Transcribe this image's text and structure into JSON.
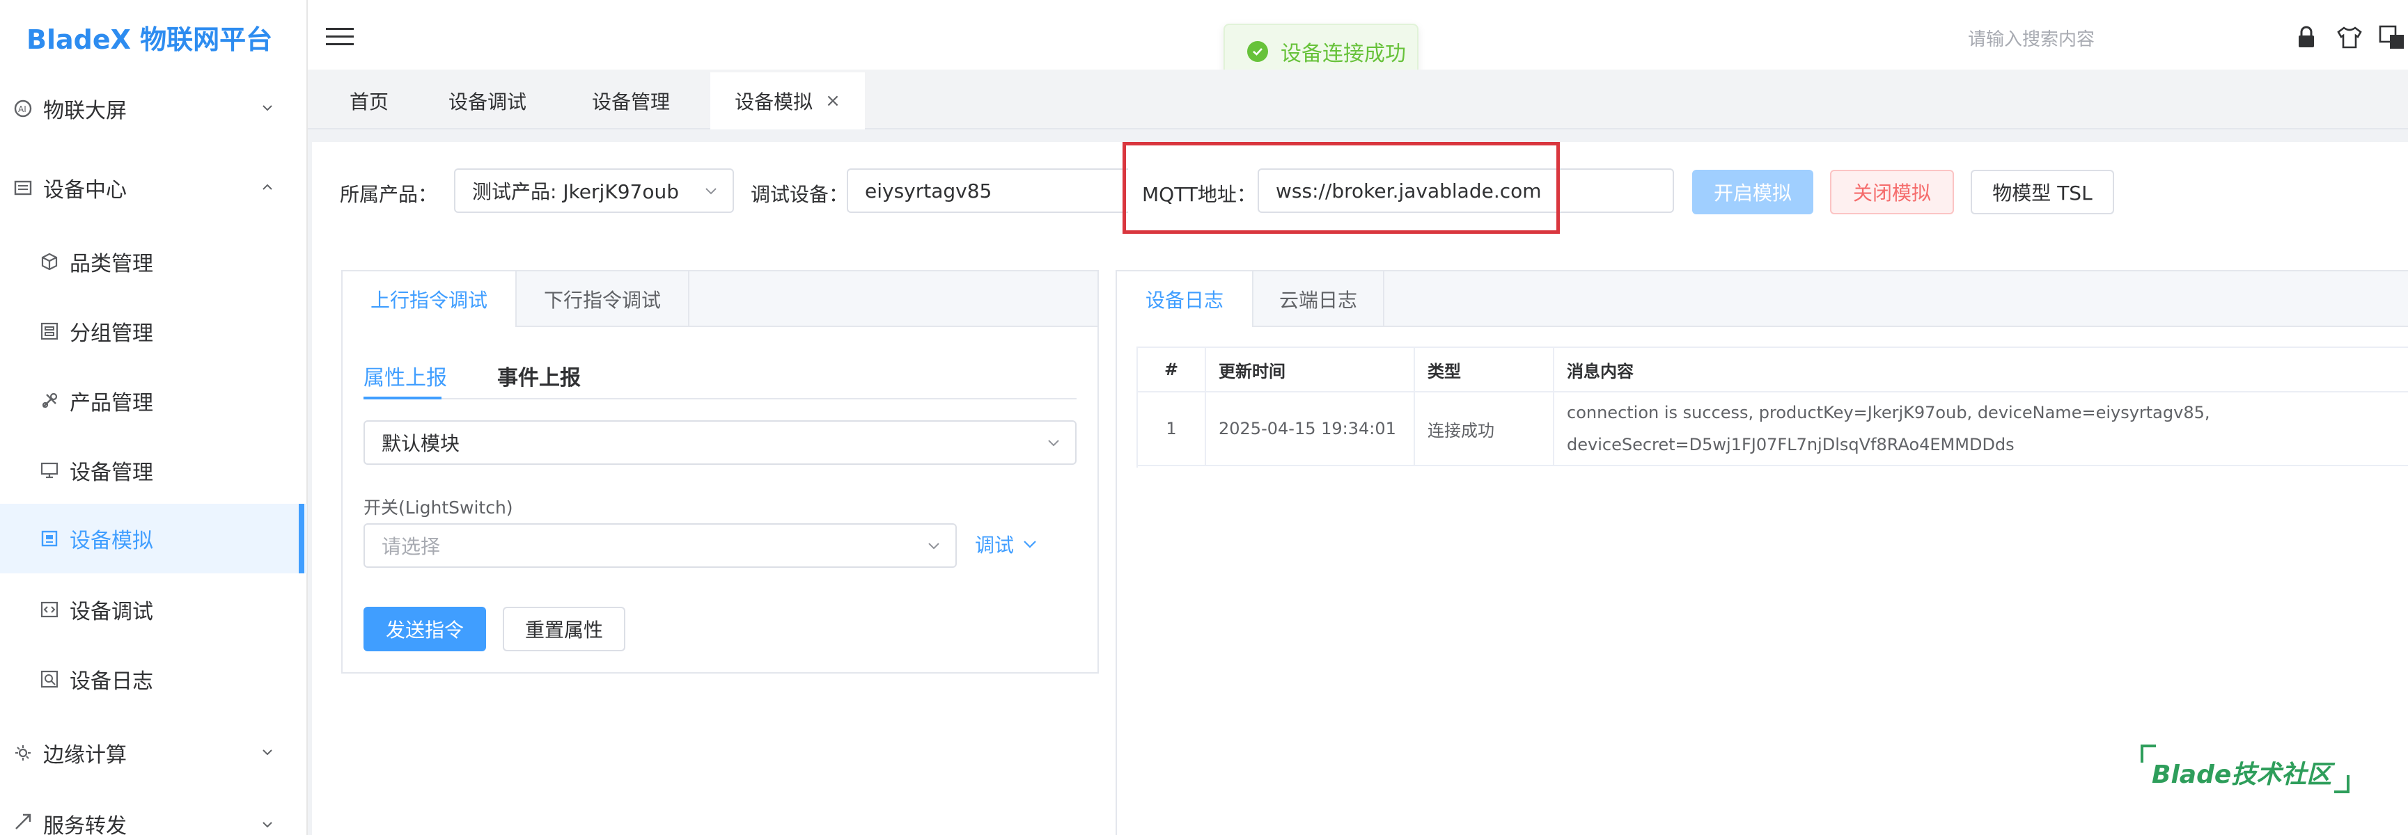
{
  "app": {
    "logo": "BladeX 物联网平台"
  },
  "sidebar": {
    "items": [
      {
        "label": "物联大屏",
        "icon": "ai-screen-icon",
        "chevron": "down"
      },
      {
        "label": "设备中心",
        "icon": "device-center-icon",
        "chevron": "up"
      },
      {
        "label": "品类管理",
        "icon": "cube-icon"
      },
      {
        "label": "分组管理",
        "icon": "group-icon"
      },
      {
        "label": "产品管理",
        "icon": "tools-icon"
      },
      {
        "label": "设备管理",
        "icon": "monitor-icon"
      },
      {
        "label": "设备模拟",
        "icon": "simulate-icon",
        "active": true
      },
      {
        "label": "设备调试",
        "icon": "code-icon"
      },
      {
        "label": "设备日志",
        "icon": "log-icon"
      },
      {
        "label": "边缘计算",
        "icon": "edge-icon",
        "chevron": "down"
      },
      {
        "label": "服务转发",
        "icon": "forward-icon",
        "chevron": "down"
      }
    ]
  },
  "header": {
    "search_placeholder": "请输入搜索内容"
  },
  "toast": {
    "message": "设备连接成功"
  },
  "tabs": [
    {
      "label": "首页"
    },
    {
      "label": "设备调试"
    },
    {
      "label": "设备管理"
    },
    {
      "label": "设备模拟",
      "active": true,
      "close": "×"
    }
  ],
  "form": {
    "product_label": "所属产品：",
    "product_value": "测试产品: JkerjK97oub",
    "device_label": "调试设备：",
    "device_value": "eiysyrtagv85",
    "mqtt_label": "MQTT地址：",
    "mqtt_value": "wss://broker.javablade.com",
    "btn_start": "开启模拟",
    "btn_close": "关闭模拟",
    "btn_tsl": "物模型 TSL"
  },
  "left_panel": {
    "tabs": [
      "上行指令调试",
      "下行指令调试"
    ],
    "subtabs": [
      "属性上报",
      "事件上报"
    ],
    "module_value": "默认模块",
    "switch_label": "开关(LightSwitch)",
    "switch_placeholder": "请选择",
    "debug_label": "调试",
    "btn_send": "发送指令",
    "btn_reset": "重置属性"
  },
  "right_panel": {
    "tabs": [
      "设备日志",
      "云端日志"
    ],
    "columns": [
      "#",
      "更新时间",
      "类型",
      "消息内容"
    ],
    "rows": [
      {
        "index": "1",
        "time": "2025-04-15 19:34:01",
        "type": "连接成功",
        "content_line1": "connection is success, productKey=JkerjK97oub, deviceName=eiysyrtagv85,",
        "content_line2": "deviceSecret=D5wj1FJ07FL7njDlsqVf8RAo4EMMDDds"
      }
    ]
  },
  "watermark": {
    "text": "Blade技术社区"
  }
}
